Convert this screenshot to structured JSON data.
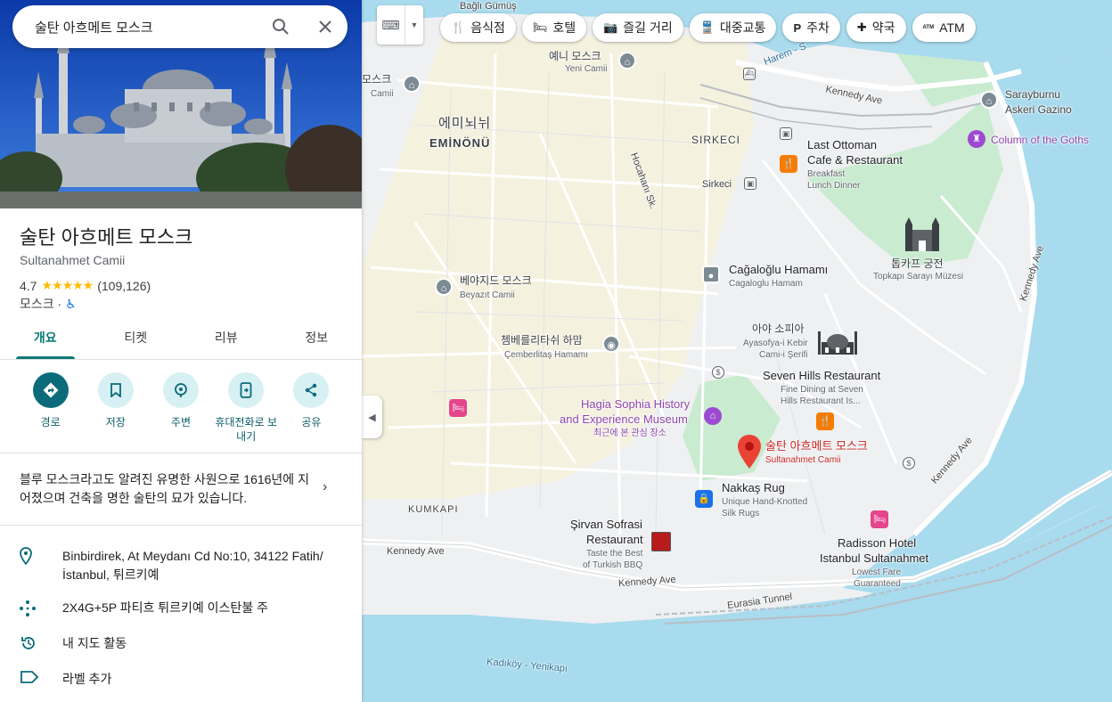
{
  "search": {
    "query": "술탄 아흐메트 모스크"
  },
  "place": {
    "name": "술탄 아흐메트 모스크",
    "name_local": "Sultanahmet Camii",
    "rating": "4.7",
    "stars": "★★★★★",
    "review_count": "(109,126)",
    "category": "모스크",
    "separator": "·",
    "accessible_icon": "♿"
  },
  "tabs": [
    "개요",
    "티켓",
    "리뷰",
    "정보"
  ],
  "actions": [
    {
      "label": "경로",
      "icon": "directions-icon"
    },
    {
      "label": "저장",
      "icon": "bookmark-icon"
    },
    {
      "label": "주변",
      "icon": "nearby-icon"
    },
    {
      "label": "휴대전화로 보내기",
      "icon": "send-to-phone-icon"
    },
    {
      "label": "공유",
      "icon": "share-icon"
    }
  ],
  "description": "블루 모스크라고도 알려진 유명한 사원으로 1616년에 지어졌으며 건축을 명한 술탄의 묘가 있습니다.",
  "info": {
    "address": "Binbirdirek, At Meydanı Cd No:10, 34122 Fatih/İstanbul, 튀르키예",
    "plus_code": "2X4G+5P 파티흐 튀르키예 이스탄불 주",
    "activity": "내 지도 활동",
    "label": "라벨 추가"
  },
  "chips": [
    {
      "label": "음식점",
      "icon": "🍴"
    },
    {
      "label": "호텔",
      "icon": "🛏"
    },
    {
      "label": "즐길 거리",
      "icon": "📷"
    },
    {
      "label": "대중교통",
      "icon": "🚆"
    },
    {
      "label": "주차",
      "icon": "P"
    },
    {
      "label": "약국",
      "icon": "✚"
    },
    {
      "label": "ATM",
      "icon": "ATM"
    }
  ],
  "map_labels": {
    "eminonu_ko": "에미뇌뉘",
    "eminonu": "EMİNÖNÜ",
    "sirkeci": "SIRKECI",
    "sirkeci_station": "Sirkeci",
    "kumkapi": "KUMKAPI",
    "yeni_camii_ko": "예니 모스크",
    "yeni_camii": "Yeni Camii",
    "left_camii_ko": "모스크",
    "left_camii": "Camii",
    "bagli": "Bağlı Gümüş",
    "kennedy": "Kennedy Ave",
    "harem": "Harem - S",
    "hocahan": "Hocahanı Sk.",
    "sarayburnu": "Sarayburnu",
    "askeri": "Askeri Gazino",
    "goths": "Column of the Goths",
    "last_ottoman_1": "Last Ottoman",
    "last_ottoman_2": "Cafe & Restaurant",
    "last_ottoman_sub1": "Breakfast",
    "last_ottoman_sub2": "Lunch Dinner",
    "topkapi_ko": "톱카프 궁전",
    "topkapi": "Topkapı Sarayı Müzesi",
    "cagaloglu": "Cağaloğlu Hamamı",
    "cagaloglu_sub": "Cagaloglu Hamam",
    "beyazit_ko": "베야지드 모스크",
    "beyazit": "Beyazıt Camii",
    "cemberlitas_ko": "쳄베를리타쉬 하맘",
    "cemberlitas": "Çemberlitaş Hamamı",
    "ayasofya_ko": "아야 소피아",
    "ayasofya_1": "Ayasofya-i Kebir",
    "ayasofya_2": "Cami-i Şerifi",
    "seven_hills": "Seven Hills Restaurant",
    "seven_hills_sub1": "Fine Dining at Seven",
    "seven_hills_sub2": "Hills Restaurant Is...",
    "hagia_1": "Hagia Sophia History",
    "hagia_2": "and Experience Museum",
    "hagia_sub": "최근에 본 관심 장소",
    "sultan_ko": "술탄 아흐메트 모스크",
    "sultan": "Sultanahmet Camii",
    "nakkas": "Nakkaş Rug",
    "nakkas_sub1": "Unique Hand-Knotted",
    "nakkas_sub2": "Silk Rugs",
    "sirvan_1": "Şirvan Sofrasi",
    "sirvan_2": "Restaurant",
    "sirvan_sub1": "Taste the Best",
    "sirvan_sub2": "of Turkish BBQ",
    "radisson_1": "Radisson Hotel",
    "radisson_2": "Istanbul Sultanahmet",
    "radisson_sub1": "Lowest Fare",
    "radisson_sub2": "Guaranteed",
    "eurasia": "Eurasia Tunnel",
    "kadikoy": "Kadıköy - Yenikapı"
  },
  "colors": {
    "water": "#a8dbee",
    "park": "#c9ebd0",
    "sand": "#fbf2cf",
    "accent": "#0b6b7a"
  }
}
